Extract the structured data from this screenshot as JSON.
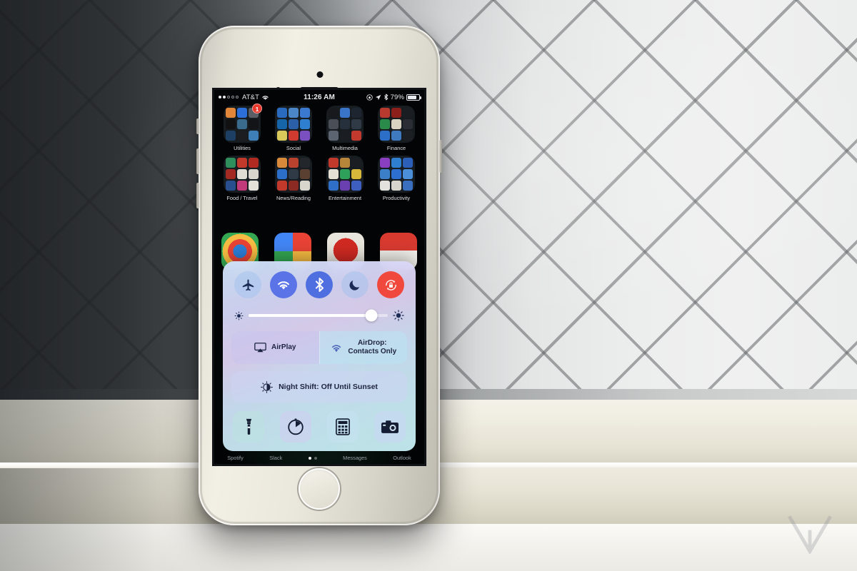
{
  "photo": {
    "subject": "iPhone displaying iOS Control Center",
    "watermark": "verge-v-logo",
    "background_description": "diagonal-tiled wall with windowsill ledge"
  },
  "phone": {
    "hardware": {
      "earpiece": "earpiece-speaker",
      "front_camera": "front-camera",
      "proximity_sensor": "proximity-sensor",
      "home_button": "home-button-touch-id",
      "volume_up": "volume-up-button",
      "volume_down": "volume-down-button",
      "mute_switch": "mute-switch",
      "power": "power-button"
    }
  },
  "statusbar": {
    "carrier": "AT&T",
    "signal_dots": [
      true,
      true,
      false,
      false,
      false
    ],
    "wifi_icon": "wifi-icon",
    "time": "11:26 AM",
    "rotation_lock_icon": "rotation-lock-icon",
    "location_icon": "location-arrow-icon",
    "bluetooth_icon": "bluetooth-icon",
    "battery_percent": "79%",
    "battery_level": 79
  },
  "homescreen": {
    "folders_row1": [
      {
        "label": "Utilities",
        "badge": "1"
      },
      {
        "label": "Social",
        "badge": null
      },
      {
        "label": "Multimedia",
        "badge": null
      },
      {
        "label": "Finance",
        "badge": null
      }
    ],
    "folders_row2": [
      {
        "label": "Food / Travel",
        "badge": null
      },
      {
        "label": "News/Reading",
        "badge": null
      },
      {
        "label": "Entertainment",
        "badge": null
      },
      {
        "label": "Productivity",
        "badge": null
      }
    ],
    "apps_row3": [
      {
        "name": "chrome-app-icon"
      },
      {
        "name": "google-photos-app-icon"
      },
      {
        "name": "red-app-icon"
      },
      {
        "name": "pokemon-go-app-icon"
      }
    ],
    "dock": [
      {
        "label": "Spotify"
      },
      {
        "label": "Slack"
      },
      {
        "label": "Messages"
      },
      {
        "label": "Outlook"
      }
    ],
    "page_dots": {
      "count": 2,
      "active_index": 0
    }
  },
  "control_center": {
    "toggles": [
      {
        "name": "airplane-mode-toggle",
        "icon": "airplane-icon",
        "state": "off"
      },
      {
        "name": "wifi-toggle",
        "icon": "wifi-icon",
        "state": "on"
      },
      {
        "name": "bluetooth-toggle",
        "icon": "bluetooth-icon",
        "state": "on"
      },
      {
        "name": "do-not-disturb-toggle",
        "icon": "moon-icon",
        "state": "off"
      },
      {
        "name": "rotation-lock-toggle",
        "icon": "rotation-lock-icon",
        "state": "on"
      }
    ],
    "brightness": {
      "name": "brightness-slider",
      "value": 88,
      "min_icon": "sun-small-icon",
      "max_icon": "sun-large-icon"
    },
    "airplay": {
      "label": "AirPlay",
      "icon": "airplay-icon"
    },
    "airdrop": {
      "label_line1": "AirDrop:",
      "label_line2": "Contacts Only",
      "icon": "airdrop-icon"
    },
    "night_shift": {
      "label": "Night Shift: Off Until Sunset",
      "icon": "night-shift-icon"
    },
    "shortcuts": [
      {
        "name": "flashlight-shortcut",
        "icon": "flashlight-icon"
      },
      {
        "name": "timer-shortcut",
        "icon": "timer-icon"
      },
      {
        "name": "calculator-shortcut",
        "icon": "calculator-icon"
      },
      {
        "name": "camera-shortcut",
        "icon": "camera-icon"
      }
    ]
  },
  "colors": {
    "toggle_on": "#5a74e8",
    "toggle_off": "#96bef0",
    "rotation_lock_on": "#f0483c",
    "badge_red": "#e8372b",
    "panel_tint": "#cee2fa"
  }
}
